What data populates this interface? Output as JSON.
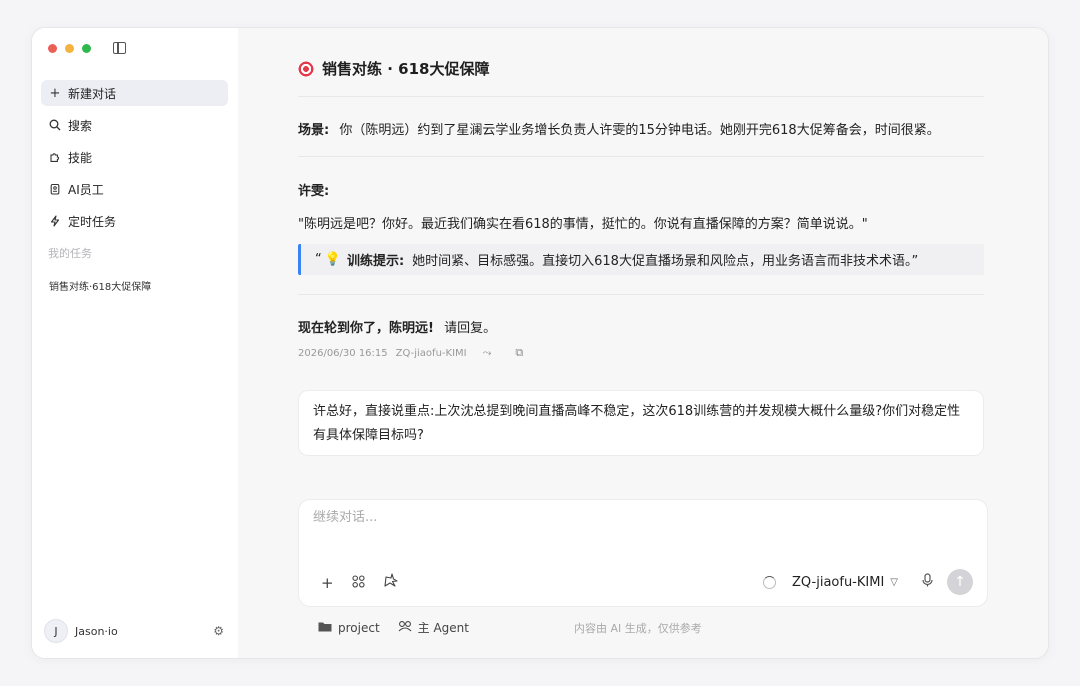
{
  "sidebar": {
    "new_chat": "新建对话",
    "items": [
      {
        "label": "搜索",
        "icon": "search-icon"
      },
      {
        "label": "技能",
        "icon": "puzzle-icon"
      },
      {
        "label": "AI员工",
        "icon": "badge-icon"
      },
      {
        "label": "定时任务",
        "icon": "bolt-icon"
      }
    ],
    "section_title": "我的任务",
    "tasks": [
      "销售对练·618大促保障"
    ],
    "user": {
      "initial": "J",
      "name": "Jason·io"
    }
  },
  "chat": {
    "title": "销售对练 · 618大促保障",
    "scene_label": "场景:",
    "scene_text": "你（陈明远）约到了星澜云学业务增长负责人许雯的15分钟电话。她刚开完618大促筹备会，时间很紧。",
    "speaker": "许雯:",
    "speaker_text": "\"陈明远是吧？你好。最近我们确实在看618的事情，挺忙的。你说有直播保障的方案？简单说说。\"",
    "tip_quote_open": "“",
    "tip_label": "训练提示:",
    "tip_text": "她时间紧、目标感强。直接切入618大促直播场景和风险点，用业务语言而非技术术语。”",
    "turn_bold": "现在轮到你了，陈明远!",
    "turn_text": "请回复。",
    "timestamp": "2026/06/30 16:15",
    "model_tag": "ZQ-jiaofu-KIMI",
    "user_message": "许总好，直接说重点:上次沈总提到晚间直播高峰不稳定，这次618训练营的并发规模大概什么量级?你们对稳定性有具体保障目标吗?"
  },
  "composer": {
    "placeholder": "继续对话...",
    "model": "ZQ-jiaofu-KIMI"
  },
  "footer": {
    "project": "project",
    "agent": "主 Agent",
    "disclaimer": "内容由 AI 生成，仅供参考"
  },
  "colors": {
    "accent": "#3b82f6",
    "traffic_red": "#ec5f57",
    "traffic_yellow": "#f4b23e",
    "traffic_green": "#2fb84e"
  }
}
